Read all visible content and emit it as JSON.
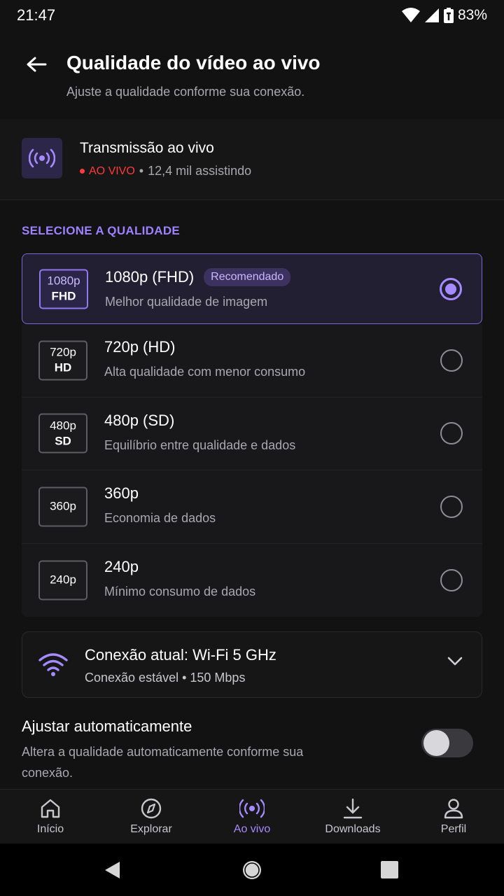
{
  "status": {
    "time": "21:47",
    "battery": "83%"
  },
  "header": {
    "title": "Qualidade do vídeo ao vivo",
    "subtitle": "Ajuste a qualidade conforme sua conexão."
  },
  "stream": {
    "title": "Transmissão ao vivo",
    "live_label": "AO VIVO",
    "separator": "•",
    "viewers": "12,4 mil assistindo"
  },
  "section_label": "SELECIONE A QUALIDADE",
  "qualities": [
    {
      "badge_top": "1080p",
      "badge_bottom": "FHD",
      "title": "1080p (FHD)",
      "tag": "Recomendado",
      "desc": "Melhor qualidade de imagem",
      "selected": true
    },
    {
      "badge_top": "720p",
      "badge_bottom": "HD",
      "title": "720p (HD)",
      "tag": "",
      "desc": "Alta qualidade com menor consumo",
      "selected": false
    },
    {
      "badge_top": "480p",
      "badge_bottom": "SD",
      "title": "480p (SD)",
      "tag": "",
      "desc": "Equilíbrio entre qualidade e dados",
      "selected": false
    },
    {
      "badge_top": "360p",
      "badge_bottom": "",
      "title": "360p",
      "tag": "",
      "desc": "Economia de dados",
      "selected": false
    },
    {
      "badge_top": "240p",
      "badge_bottom": "",
      "title": "240p",
      "tag": "",
      "desc": "Mínimo consumo de dados",
      "selected": false
    }
  ],
  "connection": {
    "title": "Conexão atual: Wi-Fi 5 GHz",
    "subtitle": "Conexão estável • 150 Mbps"
  },
  "auto_adjust": {
    "title": "Ajustar automaticamente",
    "desc": "Altera a qualidade automaticamente conforme sua conexão.",
    "enabled": false
  },
  "bottom_nav": [
    {
      "label": "Início",
      "icon": "home-icon"
    },
    {
      "label": "Explorar",
      "icon": "compass-icon"
    },
    {
      "label": "Ao vivo",
      "icon": "live-icon",
      "active": true
    },
    {
      "label": "Downloads",
      "icon": "download-icon"
    },
    {
      "label": "Perfil",
      "icon": "person-icon"
    }
  ],
  "colors": {
    "accent": "#a58bff",
    "live": "#ff3b3b",
    "background": "#121212"
  }
}
